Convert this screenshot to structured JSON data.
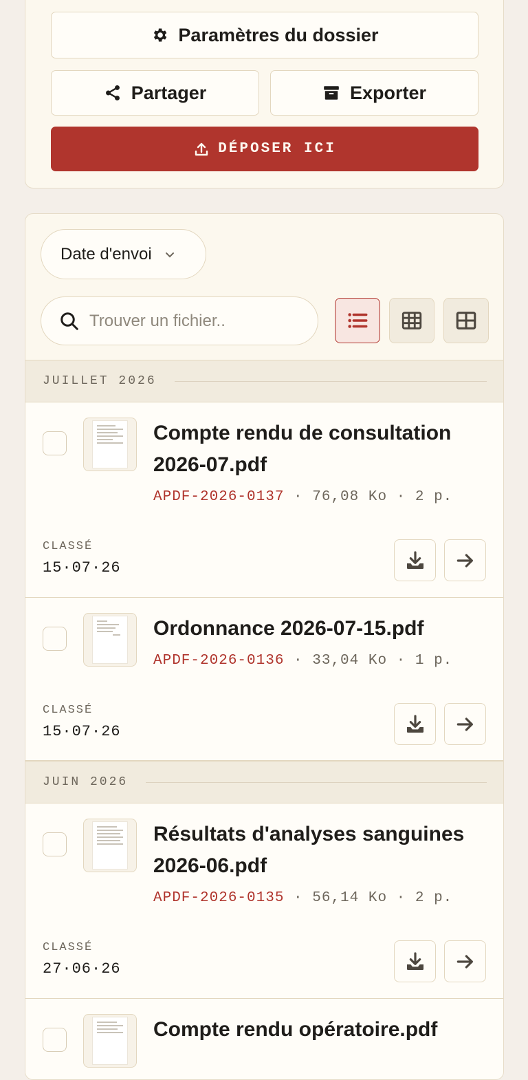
{
  "actions": {
    "settings_label": "Paramètres du dossier",
    "share_label": "Partager",
    "export_label": "Exporter",
    "deposit_label": "DÉPOSER ICI"
  },
  "toolbar": {
    "sort_label": "Date d'envoi",
    "search_placeholder": "Trouver un fichier..",
    "active_view": "list"
  },
  "groups": [
    {
      "month": "JUILLET 2026",
      "files": [
        {
          "name": "Compte rendu de consultation 2026-07.pdf",
          "ref": "APDF-2026-0137",
          "details": " · 76,08 Ko · 2 p.",
          "status": "CLASSÉ",
          "date": "15·07·26"
        },
        {
          "name": "Ordonnance 2026-07-15.pdf",
          "ref": "APDF-2026-0136",
          "details": " · 33,04 Ko · 1 p.",
          "status": "CLASSÉ",
          "date": "15·07·26"
        }
      ]
    },
    {
      "month": "JUIN 2026",
      "files": [
        {
          "name": "Résultats d'analyses sanguines 2026-06.pdf",
          "ref": "APDF-2026-0135",
          "details": " · 56,14 Ko · 2 p.",
          "status": "CLASSÉ",
          "date": "27·06·26"
        },
        {
          "name": "Compte rendu opératoire.pdf"
        }
      ]
    }
  ],
  "colors": {
    "accent": "#b0352d",
    "card_bg": "#fcf8ee",
    "page_bg": "#f4efe9"
  }
}
